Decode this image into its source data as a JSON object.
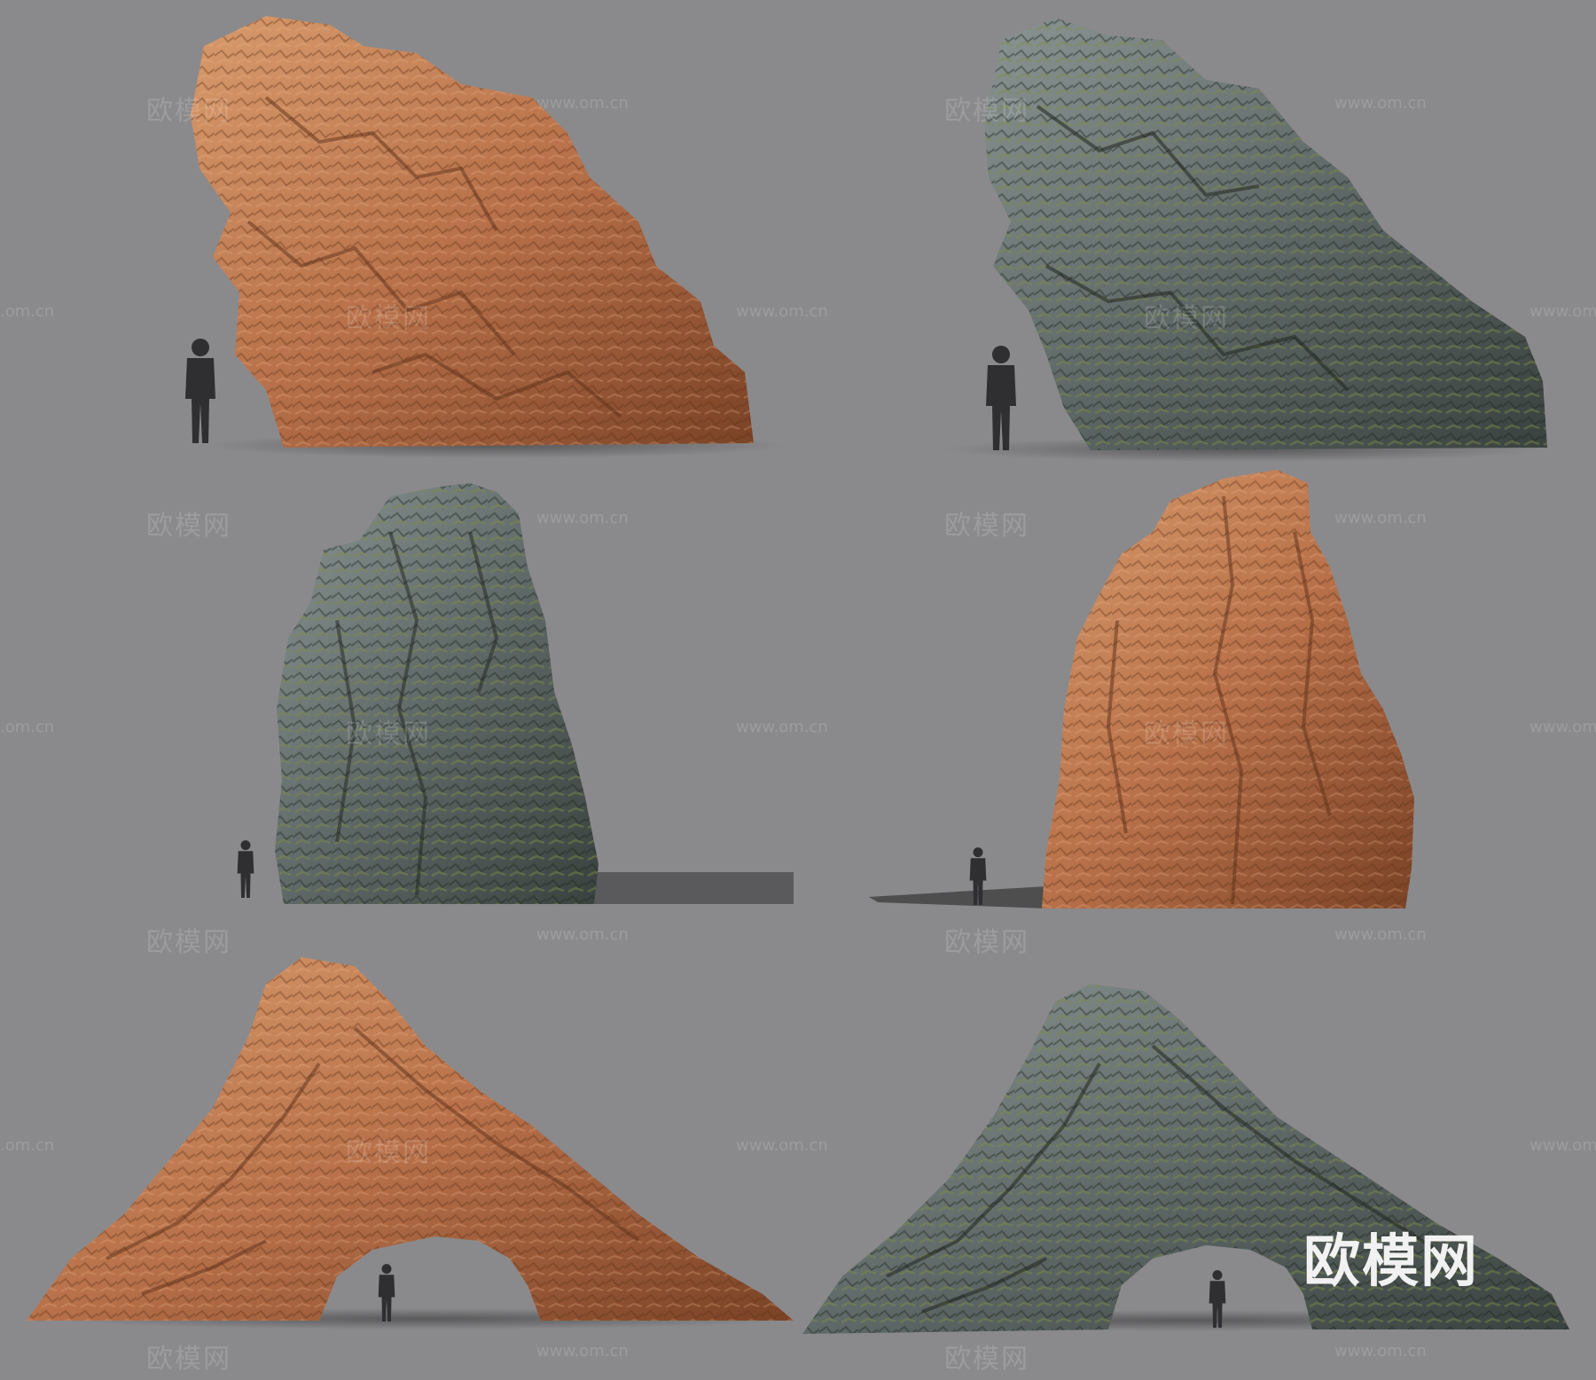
{
  "scene": {
    "background_color": "#8a8a8c",
    "panels": [
      {
        "rock": "tilted-boulder",
        "color": "orange-sandstone"
      },
      {
        "rock": "tilted-boulder",
        "color": "grey-mossy"
      },
      {
        "rock": "tall-pillar",
        "color": "grey-mossy"
      },
      {
        "rock": "tall-pillar",
        "color": "orange-sandstone"
      },
      {
        "rock": "arch",
        "color": "orange-sandstone"
      },
      {
        "rock": "arch",
        "color": "grey-mossy"
      }
    ],
    "colors": {
      "sandstone_light": "#c98a5e",
      "sandstone_dark": "#7a4226",
      "mossy_light": "#7c8684",
      "mossy_dark": "#3e4743",
      "moss": "#6b7a3f",
      "silhouette": "#2f2f31",
      "shadow": "#4a4a4c"
    }
  },
  "watermark": {
    "site_cn": "欧模网",
    "site_url": "www.om.cn",
    "url_fragment": ".om.cn"
  },
  "logo": {
    "text": "欧模网"
  }
}
